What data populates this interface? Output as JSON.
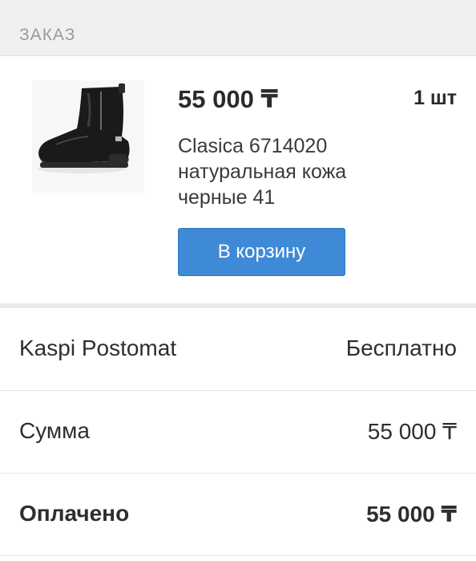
{
  "section": {
    "title": "ЗАКАЗ"
  },
  "order": {
    "price": "55 000 ₸",
    "quantity": "1 шт",
    "description_lines": [
      "Clasica 6714020",
      "натуральная кожа",
      "черные 41"
    ],
    "image_icon": "boot-photo",
    "cart_button_label": "В корзину",
    "button_color": "#3f8ad6"
  },
  "summary": {
    "rows": [
      {
        "label": "Kaspi Postomat",
        "value": "Бесплатно"
      },
      {
        "label": "Сумма",
        "value": "55 000 ₸"
      },
      {
        "label": "Оплачено",
        "value": "55 000 ₸"
      }
    ]
  }
}
